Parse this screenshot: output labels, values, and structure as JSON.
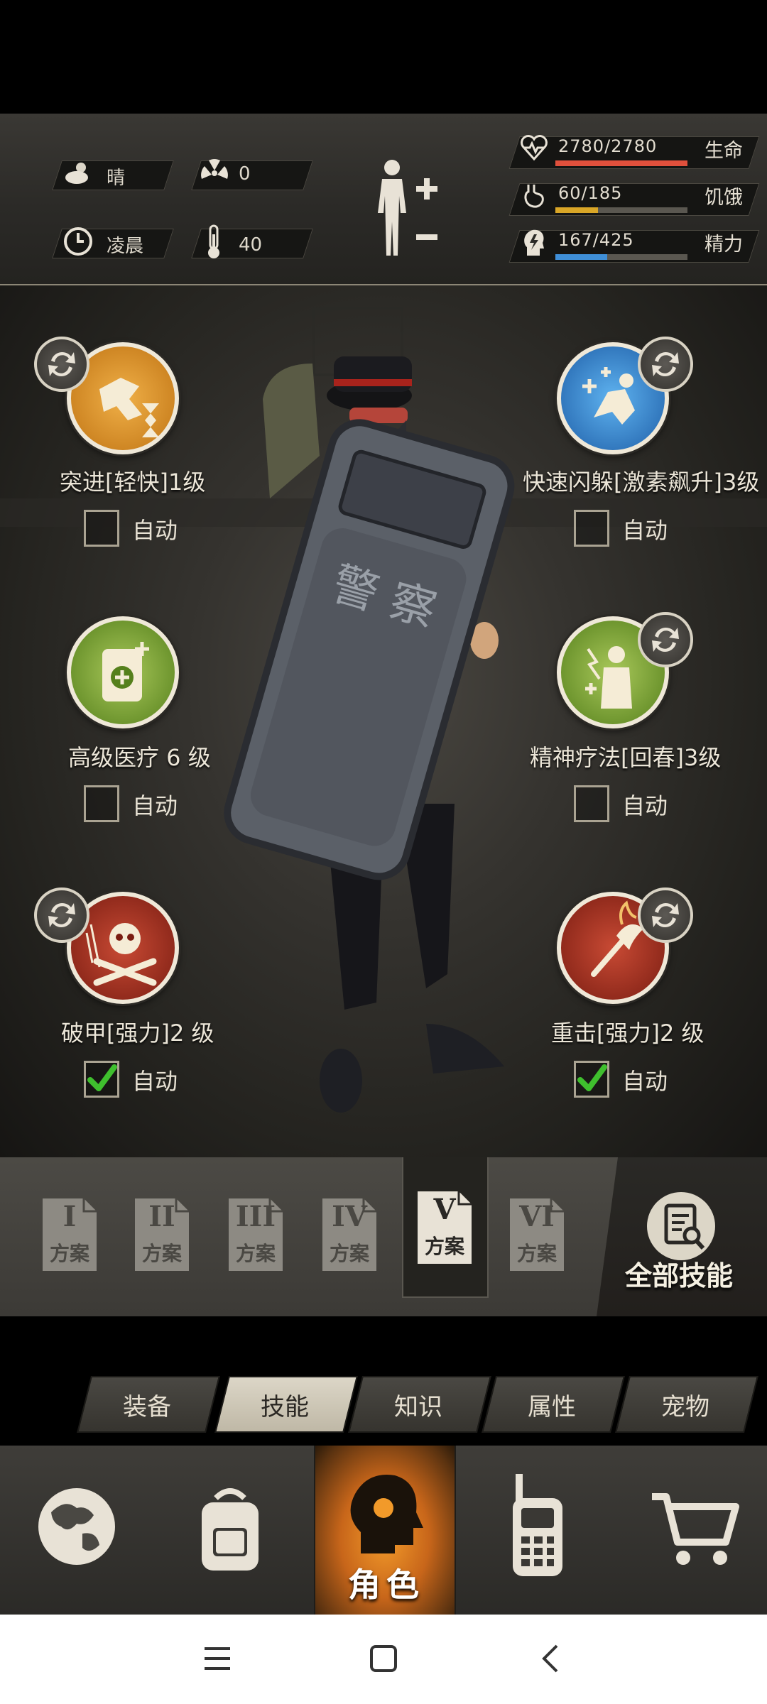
{
  "environment": {
    "weather": {
      "icon": "weather-cloud-icon",
      "label": "晴"
    },
    "radiation": {
      "icon": "radiation-icon",
      "value": "0"
    },
    "time": {
      "icon": "clock-icon",
      "label": "凌晨"
    },
    "temperature": {
      "icon": "thermometer-icon",
      "value": "40"
    }
  },
  "vitals": {
    "health": {
      "icon": "heart-rate-icon",
      "text": "2780/2780",
      "label": "生命",
      "fraction": 1.0,
      "color": "#e0503c"
    },
    "hunger": {
      "icon": "stomach-icon",
      "text": "60/185",
      "label": "饥饿",
      "fraction": 0.324,
      "color": "#d9a627"
    },
    "energy": {
      "icon": "energy-head-icon",
      "text": "167/425",
      "label": "精力",
      "fraction": 0.393,
      "color": "#3f8fd8"
    }
  },
  "skills": [
    {
      "name": "突进[轻快]1级",
      "auto_label": "自动",
      "auto_checked": false,
      "swappable": true,
      "icon": "sprint-hourglass-icon",
      "color": "#d88a1e"
    },
    {
      "name": "快速闪躲[激素飙升]3级",
      "auto_label": "自动",
      "auto_checked": false,
      "swappable": true,
      "icon": "dodge-heal-icon",
      "color": "#2c7ac4"
    },
    {
      "name": "高级医疗 6 级",
      "auto_label": "自动",
      "auto_checked": false,
      "swappable": false,
      "icon": "medkit-icon",
      "color": "#6f9a2a"
    },
    {
      "name": "精神疗法[回春]3级",
      "auto_label": "自动",
      "auto_checked": false,
      "swappable": true,
      "icon": "spirit-therapy-icon",
      "color": "#6f9a2a"
    },
    {
      "name": "破甲[强力]2 级",
      "auto_label": "自动",
      "auto_checked": true,
      "swappable": true,
      "icon": "skull-crossbones-icon",
      "color": "#a8321f"
    },
    {
      "name": "重击[强力]2 级",
      "auto_label": "自动",
      "auto_checked": true,
      "swappable": true,
      "icon": "flaming-axe-icon",
      "color": "#a8321f"
    }
  ],
  "plans": {
    "items": [
      {
        "numeral": "I",
        "label": "方案"
      },
      {
        "numeral": "II",
        "label": "方案"
      },
      {
        "numeral": "III",
        "label": "方案"
      },
      {
        "numeral": "IV",
        "label": "方案"
      },
      {
        "numeral": "V",
        "label": "方案"
      },
      {
        "numeral": "VI",
        "label": "方案"
      }
    ],
    "active_index": 4,
    "all_skills_label": "全部技能"
  },
  "tabs": {
    "items": [
      "装备",
      "技能",
      "知识",
      "属性",
      "宠物"
    ],
    "active_index": 1
  },
  "bottom_nav": {
    "items": [
      {
        "icon": "globe-icon"
      },
      {
        "icon": "backpack-icon"
      },
      {
        "icon": "character-head-icon",
        "label": "角色"
      },
      {
        "icon": "walkie-talkie-icon"
      },
      {
        "icon": "shopping-cart-icon"
      }
    ],
    "active_index": 2
  },
  "android_nav": [
    "menu-icon",
    "home-icon",
    "back-icon"
  ]
}
